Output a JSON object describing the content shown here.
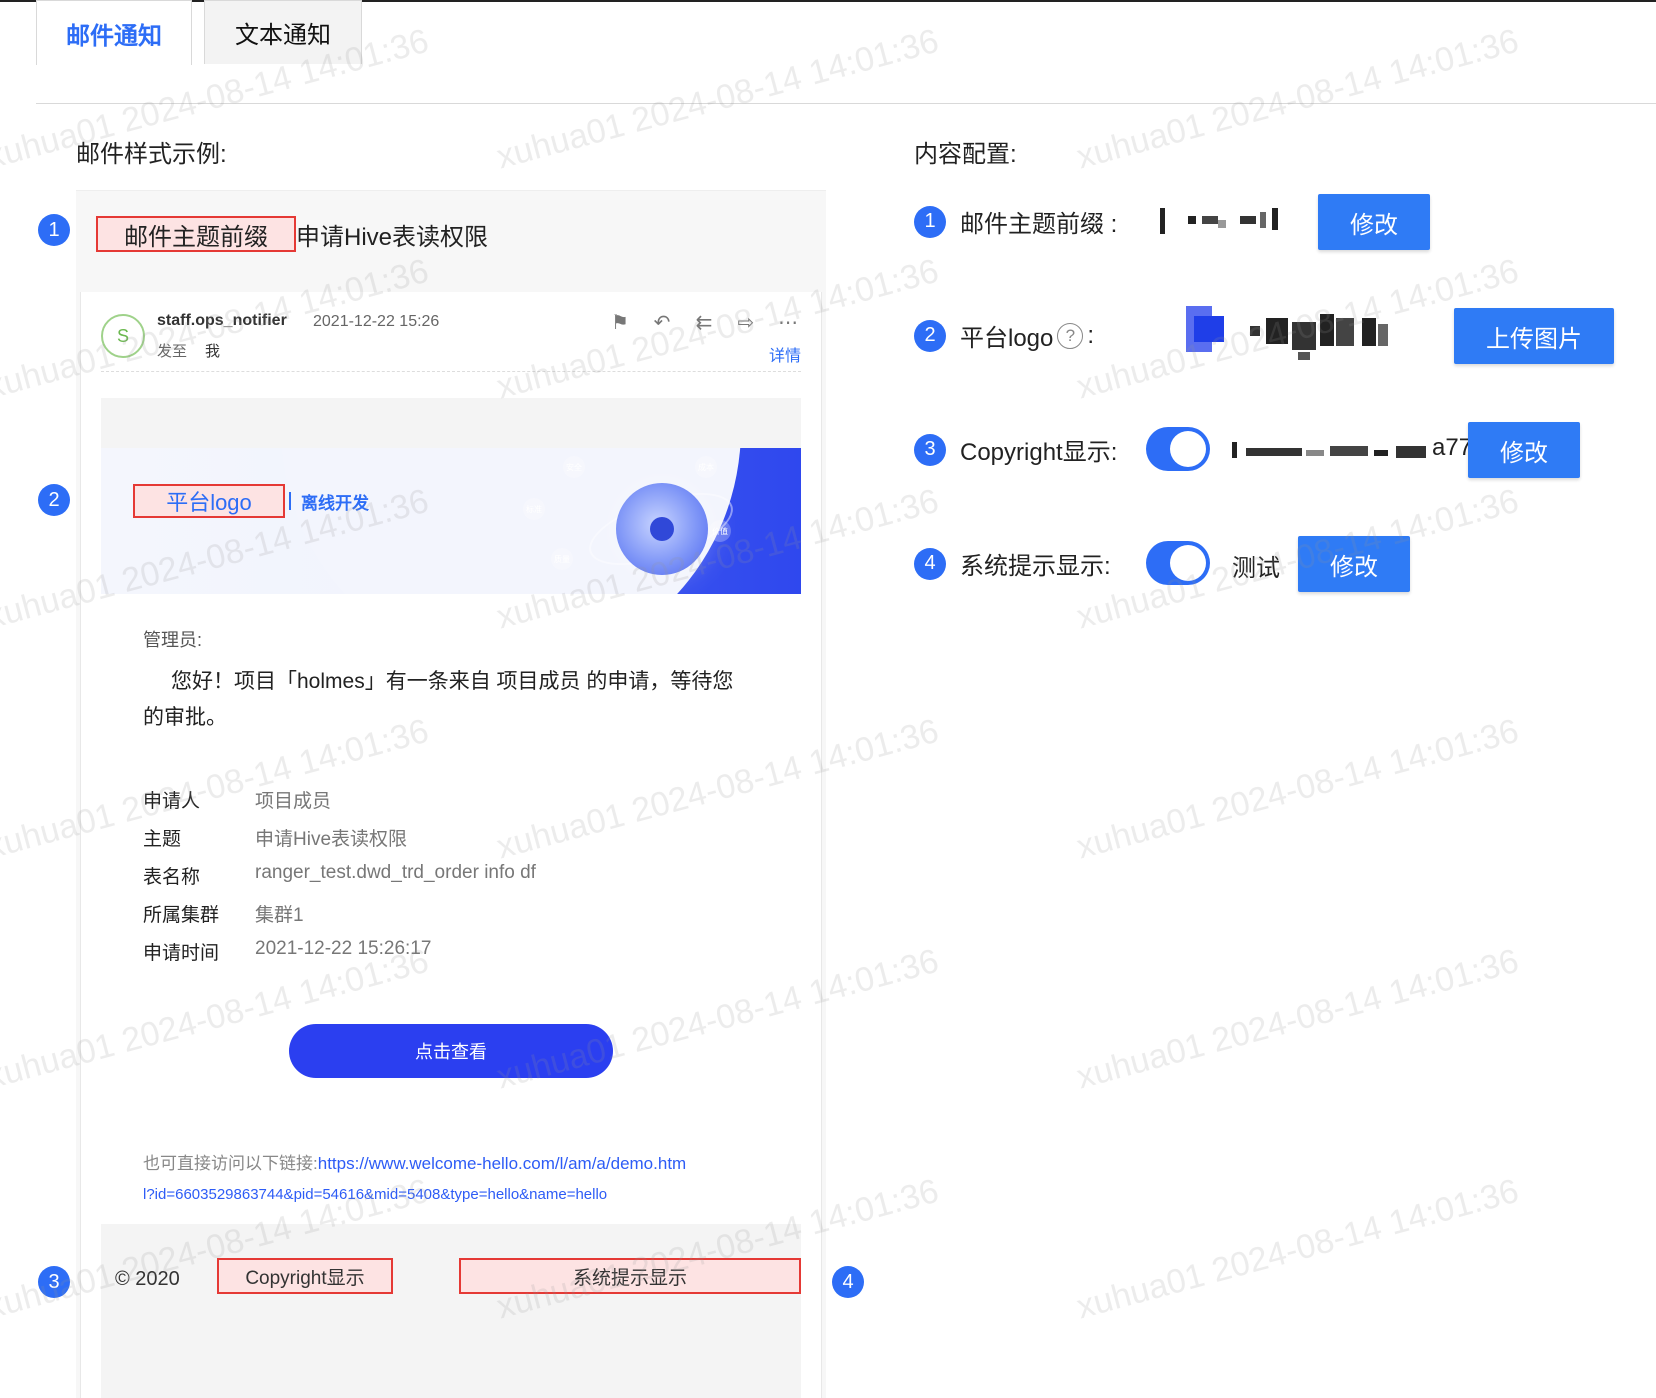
{
  "tabs": [
    {
      "label": "邮件通知",
      "active": true
    },
    {
      "label": "文本通知",
      "active": false
    }
  ],
  "preview": {
    "title": "邮件样式示例:",
    "subject_prefix": "邮件主题前缀",
    "subject": "申请Hive表读权限",
    "mail": {
      "avatar": "S",
      "sender": "staff.ops_notifier",
      "time": "2021-12-22 15:26",
      "to_label": "发至",
      "to": "我",
      "detail": "详情",
      "icons": [
        "flag-icon",
        "reply-icon",
        "reply-all-icon",
        "forward-icon",
        "more-icon"
      ]
    },
    "banner": {
      "logo": "平台logo",
      "sub": "离线开发",
      "bubbles": [
        "安全",
        "成本",
        "标准",
        "价值",
        "质量"
      ]
    },
    "body": {
      "greeting_to": "管理员:",
      "greeting": "您好！项目「holmes」有一条来自 项目成员 的申请，等待您的审批。",
      "rows": [
        {
          "label": "申请人",
          "value": "项目成员"
        },
        {
          "label": "主题",
          "value": "申请Hive表读权限"
        },
        {
          "label": "表名称",
          "value": "ranger_test.dwd_trd_order info df"
        },
        {
          "label": "所属集群",
          "value": "集群1"
        },
        {
          "label": "申请时间",
          "value": "2021-12-22 15:26:17"
        }
      ],
      "button": "点击查看",
      "link_prefix": "也可直接访问以下链接:",
      "link_part1": "https://www.welcome-hello.com/l/am/a/demo.htm",
      "link_part2": "l?id=6603529863744&pid=54616&mid=5408&type=hello&name=hello"
    },
    "footer": {
      "year": "© 2020",
      "copyright": "Copyright显示",
      "tip": "系统提示显示"
    }
  },
  "markers": [
    "1",
    "2",
    "3",
    "4"
  ],
  "config": {
    "title": "内容配置:",
    "subject_label": "邮件主题前缀 :",
    "subject_btn": "修改",
    "logo_label": "平台logo",
    "logo_help": "?",
    "logo_colon": ":",
    "logo_btn": "上传图片",
    "copyright_label": "Copyright显示:",
    "copyright_suffix": "a77",
    "copyright_btn": "修改",
    "tip_label": "系统提示显示:",
    "tip_value": "测试",
    "tip_btn": "修改"
  },
  "watermark": "xuhua01 2024-08-14 14:01:36",
  "colors": {
    "accent": "#2d6df6",
    "button": "#2f7bf5",
    "highlight_border": "#e53935",
    "highlight_fill": "#fde3e3",
    "view_button": "#2b3ff0"
  }
}
